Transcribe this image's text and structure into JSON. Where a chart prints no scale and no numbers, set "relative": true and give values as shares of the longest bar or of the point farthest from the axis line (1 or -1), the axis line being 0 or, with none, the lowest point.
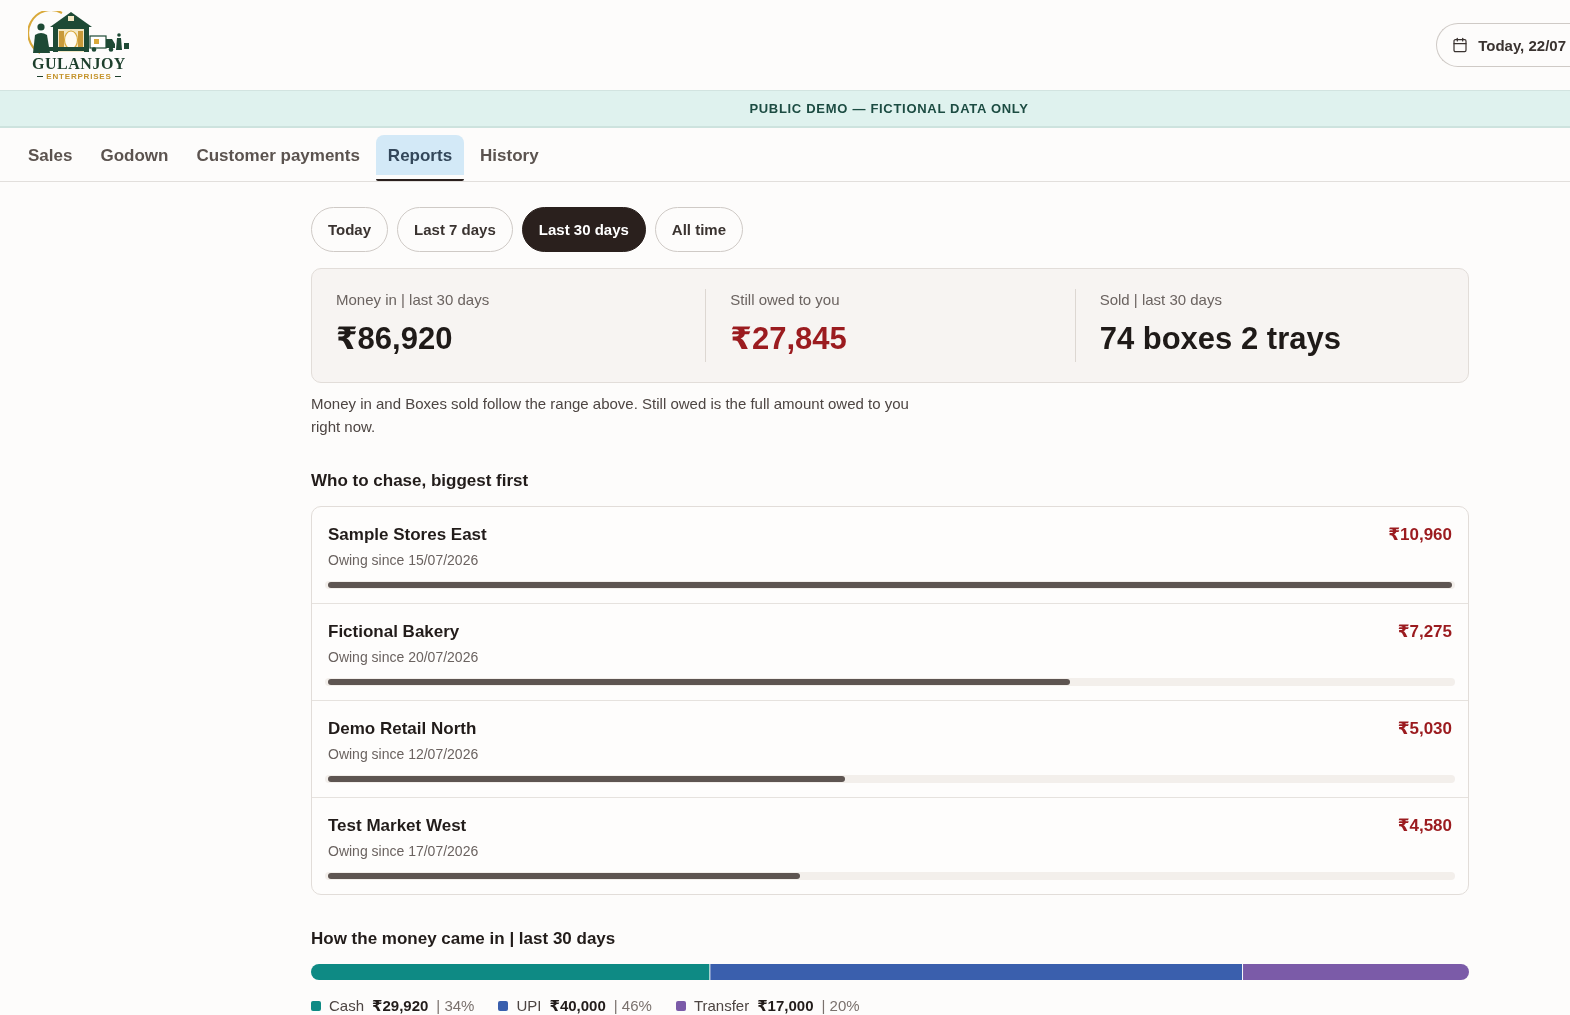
{
  "header": {
    "logo": {
      "name": "GULANJOY",
      "tagline": "ENTERPRISES"
    },
    "date_button": {
      "label": "Today, 22/07"
    }
  },
  "banner": {
    "text": "PUBLIC DEMO — FICTIONAL DATA ONLY"
  },
  "tabs": [
    {
      "label": "Sales",
      "selected": false
    },
    {
      "label": "Godown",
      "selected": false
    },
    {
      "label": "Customer payments",
      "selected": false
    },
    {
      "label": "Reports",
      "selected": true
    },
    {
      "label": "History",
      "selected": false
    }
  ],
  "range_buttons": [
    {
      "label": "Today",
      "selected": false
    },
    {
      "label": "Last 7 days",
      "selected": false
    },
    {
      "label": "Last 30 days",
      "selected": true
    },
    {
      "label": "All time",
      "selected": false
    }
  ],
  "summary": [
    {
      "label": "Money in | last 30 days",
      "value": "₹86,920",
      "kind": "plain"
    },
    {
      "label": "Still owed to you",
      "value": "₹27,845",
      "kind": "owed"
    },
    {
      "label": "Sold | last 30 days",
      "value": "74 boxes 2 trays",
      "kind": "plain"
    }
  ],
  "summary_note": "Money in and Boxes sold follow the range above. Still owed is the full amount owed to you right now.",
  "chase": {
    "title": "Who to chase, biggest first",
    "rows": [
      {
        "name": "Sample Stores East",
        "since": "Owing since 15/07/2026",
        "amount": "₹10,960",
        "level": 1.0
      },
      {
        "name": "Fictional Bakery",
        "since": "Owing since 20/07/2026",
        "amount": "₹7,275",
        "level": 0.66
      },
      {
        "name": "Demo Retail North",
        "since": "Owing since 12/07/2026",
        "amount": "₹5,030",
        "level": 0.46
      },
      {
        "name": "Test Market West",
        "since": "Owing since 17/07/2026",
        "amount": "₹4,580",
        "level": 0.42
      }
    ]
  },
  "money_in": {
    "title": "How the money came in | last 30 days",
    "chart_data": {
      "type": "bar",
      "orientation": "horizontal",
      "stacked": true,
      "relative": true,
      "series": [
        {
          "name": "Cash",
          "color": "#0e8a84",
          "values": [
            0.344
          ]
        },
        {
          "name": "UPI",
          "color": "#3a5fad",
          "values": [
            0.46
          ]
        },
        {
          "name": "Transfer",
          "color": "#7b5ba8",
          "values": [
            0.196
          ]
        }
      ]
    },
    "legend": [
      {
        "amount": "₹29,920",
        "share": "| 34%"
      },
      {
        "amount": "₹40,000",
        "share": "| 46%"
      },
      {
        "amount": "₹17,000",
        "share": "| 20%"
      }
    ]
  }
}
